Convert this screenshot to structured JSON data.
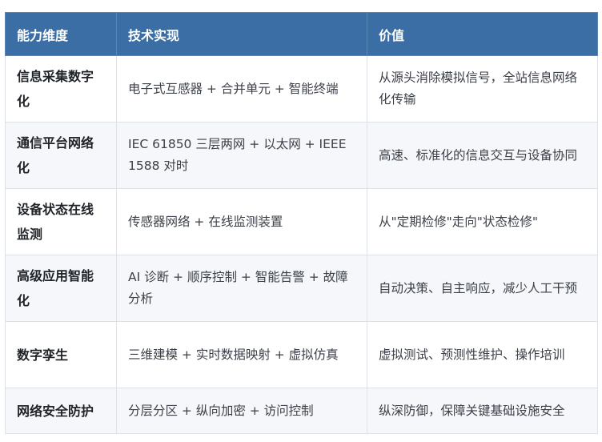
{
  "table": {
    "headers": [
      "能力维度",
      "技术实现",
      "价值"
    ],
    "rows": [
      {
        "dimension": "信息采集数字化",
        "tech": "电子式互感器 + 合并单元 + 智能终端",
        "value": "从源头消除模拟信号，全站信息网络化传输"
      },
      {
        "dimension": "通信平台网络化",
        "tech": "IEC 61850 三层两网 + 以太网 + IEEE 1588 对时",
        "value": "高速、标准化的信息交互与设备协同"
      },
      {
        "dimension": "设备状态在线监测",
        "tech": "传感器网络 + 在线监测装置",
        "value": "从\"定期检修\"走向\"状态检修\""
      },
      {
        "dimension": "高级应用智能化",
        "tech": "AI 诊断 + 顺序控制 + 智能告警 + 故障分析",
        "value": "自动决策、自主响应，减少人工干预"
      },
      {
        "dimension": "数字孪生",
        "tech": "三维建模 + 实时数据映射 + 虚拟仿真",
        "value": "虚拟测试、预测性维护、操作培训"
      },
      {
        "dimension": "网络安全防护",
        "tech": "分层分区 + 纵向加密 + 访问控制",
        "value": "纵深防御，保障关键基础设施安全"
      }
    ]
  },
  "colors": {
    "header_bg": "#3a6ea5",
    "header_text": "#ffffff",
    "alt_row_bg": "#f5f7fa",
    "border": "#dde2e8"
  }
}
